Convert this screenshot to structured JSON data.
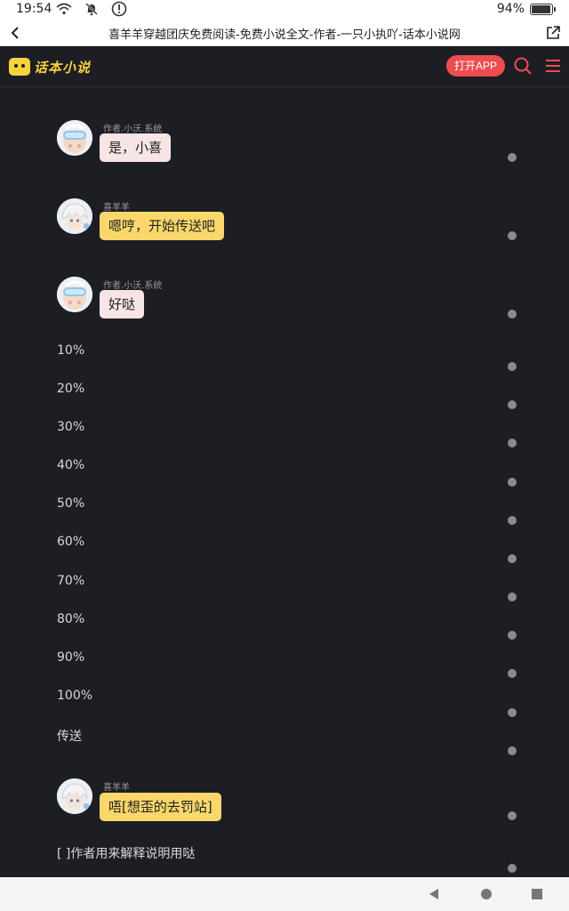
{
  "status_bar": {
    "time": "19:54",
    "battery": "94%",
    "battery_level": 0.94,
    "icons": [
      "wifi-icon",
      "notifications-off-icon",
      "alert-icon"
    ]
  },
  "browser": {
    "title": "喜羊羊穿越团庆免费阅读-免费小说全文-作者-一只小执吖-话本小说网"
  },
  "site_header": {
    "logo_text": "话本小说",
    "open_app_label": "打开APP"
  },
  "messages": [
    {
      "kind": "chat",
      "speaker": "作者.小沃.系统",
      "text": "是，小喜",
      "bubble_color": "#f7e4e4",
      "avatar": "astronaut-avatar"
    },
    {
      "kind": "chat",
      "speaker": "喜羊羊",
      "text": "嗯哼，开始传送吧",
      "bubble_color": "#f9d76a",
      "avatar": "white-hair-avatar"
    },
    {
      "kind": "chat",
      "speaker": "作者.小沃.系统",
      "text": "好哒",
      "bubble_color": "#f7e4e4",
      "avatar": "astronaut-avatar"
    },
    {
      "kind": "plain",
      "text": "10%"
    },
    {
      "kind": "plain",
      "text": "20%"
    },
    {
      "kind": "plain",
      "text": "30%"
    },
    {
      "kind": "plain",
      "text": "40%"
    },
    {
      "kind": "plain",
      "text": "50%"
    },
    {
      "kind": "plain",
      "text": "60%"
    },
    {
      "kind": "plain",
      "text": "70%"
    },
    {
      "kind": "plain",
      "text": "80%"
    },
    {
      "kind": "plain",
      "text": "90%"
    },
    {
      "kind": "plain",
      "text": "100%"
    },
    {
      "kind": "plain",
      "text": "传送"
    },
    {
      "kind": "chat",
      "speaker": "喜羊羊",
      "text": "唔[想歪的去罚站]",
      "bubble_color": "#f9d76a",
      "avatar": "white-hair-avatar"
    },
    {
      "kind": "plain",
      "text": "[ ]作者用来解释说明用哒"
    }
  ],
  "nav_bar": {
    "icons": [
      "back-triangle-icon",
      "home-circle-icon",
      "recents-square-icon"
    ]
  },
  "colors": {
    "background": "#1d1e23",
    "accent_red": "#ee4d4f",
    "logo_yellow": "#f6d23e"
  }
}
